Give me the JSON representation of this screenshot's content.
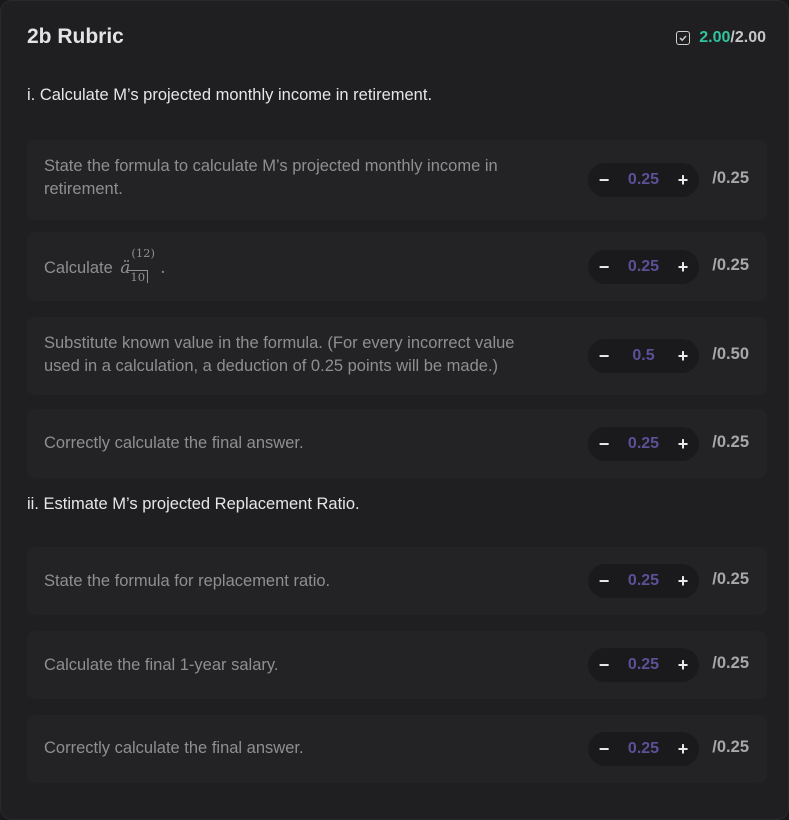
{
  "header": {
    "title": "2b Rubric",
    "score_got": "2.00",
    "score_total": "/2.00"
  },
  "sections": [
    {
      "title": "i. Calculate M’s projected monthly income in retirement.",
      "items": [
        {
          "text": "State the formula to calculate M’s projected monthly income in retirement.",
          "value": "0.25",
          "max": "/0.25"
        },
        {
          "text": "Calculate ",
          "math": {
            "base": "ä",
            "sup": "(12)",
            "sub": "10",
            "trail": "."
          },
          "value": "0.25",
          "max": "/0.25"
        },
        {
          "text": "Substitute known value in the formula. (For every incorrect value used in a calculation, a deduction of 0.25 points will be made.)",
          "value": "0.5",
          "max": "/0.50"
        },
        {
          "text": "Correctly calculate the final answer.",
          "value": "0.25",
          "max": "/0.25"
        }
      ]
    },
    {
      "title": "ii. Estimate M’s projected Replacement Ratio.",
      "items": [
        {
          "text": "State the formula for replacement ratio.",
          "value": "0.25",
          "max": "/0.25"
        },
        {
          "text": "Calculate the final 1-year salary.",
          "value": "0.25",
          "max": "/0.25"
        },
        {
          "text": "Correctly calculate the final answer.",
          "value": "0.25",
          "max": "/0.25"
        }
      ]
    }
  ],
  "controls": {
    "minus": "−",
    "plus": "+"
  },
  "colors": {
    "score_green": "#30c39e",
    "value_purple": "#5c5098"
  }
}
